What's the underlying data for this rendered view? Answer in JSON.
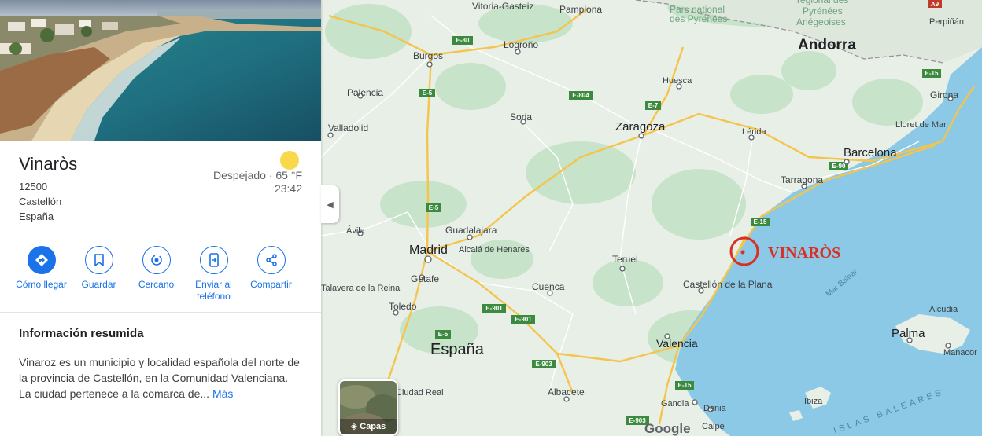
{
  "place": {
    "name": "Vinaròs",
    "postal_code": "12500",
    "province": "Castellón",
    "country": "España"
  },
  "weather": {
    "condition": "Despejado · 65 °F",
    "time": "23:42",
    "icon": "sun-icon",
    "sun_color": "#f9d94b"
  },
  "actions": [
    {
      "label": "Cómo llegar",
      "icon": "directions-icon"
    },
    {
      "label": "Guardar",
      "icon": "bookmark-icon"
    },
    {
      "label": "Cercano",
      "icon": "nearby-icon"
    },
    {
      "label": "Enviar al teléfono",
      "icon": "send-to-phone-icon"
    },
    {
      "label": "Compartir",
      "icon": "share-icon"
    }
  ],
  "summary": {
    "title": "Información resumida",
    "text": "Vinaroz es un municipio y localidad española del norte de la provincia de Castellón, en la Comunidad Valenciana. La ciudad pertenece a la comarca de... ",
    "more": "Más"
  },
  "map": {
    "marker_label": "VINARÒS",
    "marker_color": "#d93025",
    "layers_label": "Capas",
    "watermark": "Google",
    "colors": {
      "sea": "#8cc9e6",
      "land": "#e8efe7",
      "forest": "#c7e3c9",
      "highway": "#f4c44d",
      "road": "#ffffff"
    },
    "cities": [
      {
        "name": "Vitoria-Gasteiz"
      },
      {
        "name": "Pamplona"
      },
      {
        "name": "Burgos"
      },
      {
        "name": "Logroño"
      },
      {
        "name": "Palencia"
      },
      {
        "name": "Valladolid"
      },
      {
        "name": "Soria"
      },
      {
        "name": "Zaragoza"
      },
      {
        "name": "Huesca"
      },
      {
        "name": "Lérida"
      },
      {
        "name": "Andorra"
      },
      {
        "name": "Perpiñán"
      },
      {
        "name": "Girona"
      },
      {
        "name": "Lloret de Mar"
      },
      {
        "name": "Barcelona"
      },
      {
        "name": "Tarragona"
      },
      {
        "name": "Madrid"
      },
      {
        "name": "Guadalajara"
      },
      {
        "name": "Alcalá de Henares"
      },
      {
        "name": "Getafe"
      },
      {
        "name": "Ávila"
      },
      {
        "name": "Talavera de la Reina"
      },
      {
        "name": "Toledo"
      },
      {
        "name": "Cuenca"
      },
      {
        "name": "Teruel"
      },
      {
        "name": "Castellón de la Plana"
      },
      {
        "name": "Valencia"
      },
      {
        "name": "España"
      },
      {
        "name": "Albacete"
      },
      {
        "name": "Ciudad Real"
      },
      {
        "name": "Gandia"
      },
      {
        "name": "Denia"
      },
      {
        "name": "Calpe"
      },
      {
        "name": "Palma"
      },
      {
        "name": "Manacor"
      },
      {
        "name": "Alcudia"
      },
      {
        "name": "Ibiza"
      }
    ],
    "features": [
      {
        "name": "Parc national des Pyrénées"
      },
      {
        "name": "Parc naturel régional des Pyrénées Ariégeoises"
      },
      {
        "name": "Mar Balear"
      },
      {
        "name": "ISLAS BALEARES"
      }
    ],
    "road_shields": [
      "E-80",
      "E-5",
      "E-804",
      "E-7",
      "E-90",
      "E-15",
      "E-901",
      "E-903",
      "A9"
    ]
  }
}
